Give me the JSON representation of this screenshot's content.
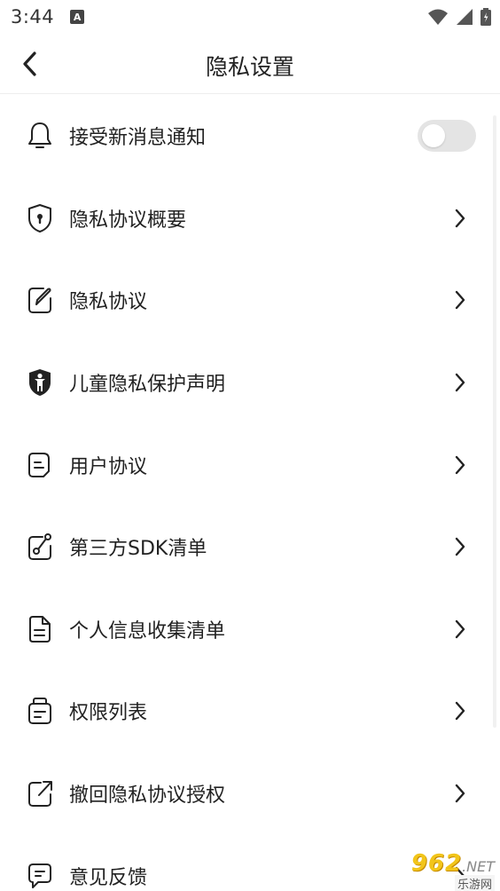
{
  "status_bar": {
    "time": "3:44",
    "notification_icon": "a-icon",
    "wifi_icon": "wifi-icon",
    "signal_icon": "signal-icon",
    "battery_icon": "battery-icon"
  },
  "app_bar": {
    "back_icon": "chevron-left-icon",
    "title": "隐私设置"
  },
  "items": [
    {
      "label": "接受新消息通知",
      "icon": "bell-icon",
      "control": "toggle",
      "toggle_on": false
    },
    {
      "label": "隐私协议概要",
      "icon": "shield-lock-icon",
      "control": "arrow"
    },
    {
      "label": "隐私协议",
      "icon": "edit-document-icon",
      "control": "arrow"
    },
    {
      "label": "儿童隐私保护声明",
      "icon": "child-shield-icon",
      "control": "arrow"
    },
    {
      "label": "用户协议",
      "icon": "document-icon",
      "control": "arrow"
    },
    {
      "label": "第三方SDK清单",
      "icon": "link-icon",
      "control": "arrow"
    },
    {
      "label": "个人信息收集清单",
      "icon": "file-text-icon",
      "control": "arrow"
    },
    {
      "label": "权限列表",
      "icon": "folder-icon",
      "control": "arrow"
    },
    {
      "label": "撤回隐私协议授权",
      "icon": "export-icon",
      "control": "arrow"
    },
    {
      "label": "意见反馈",
      "icon": "feedback-icon",
      "control": "arrow"
    }
  ],
  "watermark": {
    "main": "962",
    "net": ".NET",
    "sub": "乐游网"
  },
  "colors": {
    "text": "#222222",
    "toggle_off": "#e4e4e4",
    "watermark": "#f2c51a"
  }
}
